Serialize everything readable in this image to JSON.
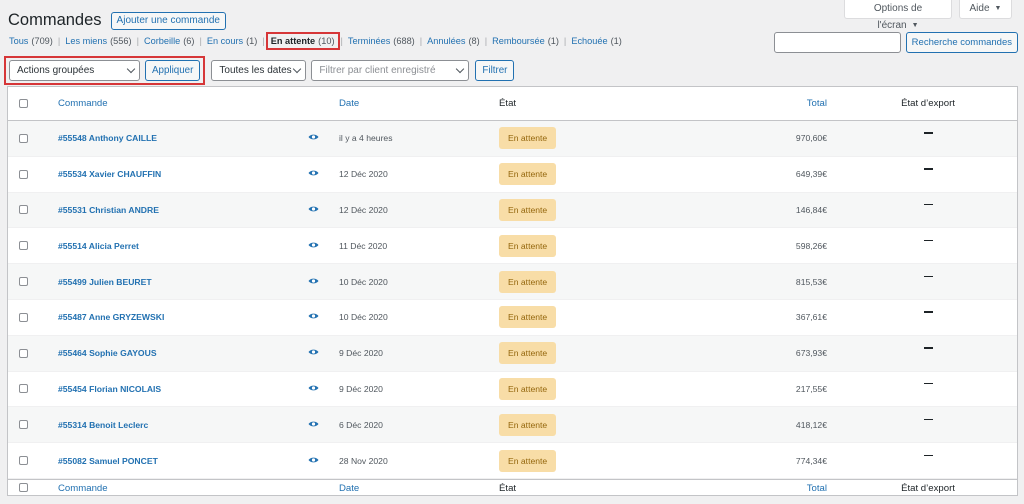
{
  "screen_meta": {
    "options_label": "Options de l'écran",
    "help_label": "Aide"
  },
  "page": {
    "title": "Commandes",
    "add_button": "Ajouter une commande"
  },
  "filters": [
    {
      "label": "Tous",
      "count": "(709)"
    },
    {
      "label": "Les miens",
      "count": "(556)"
    },
    {
      "label": "Corbeille",
      "count": "(6)"
    },
    {
      "label": "En cours",
      "count": "(1)"
    },
    {
      "label": "En attente",
      "count": "(10)",
      "current": true
    },
    {
      "label": "Terminées",
      "count": "(688)"
    },
    {
      "label": "Annulées",
      "count": "(8)"
    },
    {
      "label": "Remboursée",
      "count": "(1)"
    },
    {
      "label": "Echouée",
      "count": "(1)"
    }
  ],
  "search": {
    "value": "",
    "button": "Recherche commandes"
  },
  "tablenav": {
    "bulk_select": "Actions groupées",
    "apply": "Appliquer",
    "dates_select": "Toutes les dates",
    "customer_placeholder": "Filtrer par client enregistré",
    "filter": "Filtrer"
  },
  "columns": {
    "order": "Commande",
    "date": "Date",
    "state": "État",
    "total": "Total",
    "export": "État d’export"
  },
  "orders": [
    {
      "order": "#55548 Anthony CAILLE",
      "date": "il y a 4 heures",
      "state": "En attente",
      "total": "970,60€"
    },
    {
      "order": "#55534 Xavier CHAUFFIN",
      "date": "12 Déc 2020",
      "state": "En attente",
      "total": "649,39€"
    },
    {
      "order": "#55531 Christian ANDRE",
      "date": "12 Déc 2020",
      "state": "En attente",
      "total": "146,84€"
    },
    {
      "order": "#55514 Alicia Perret",
      "date": "11 Déc 2020",
      "state": "En attente",
      "total": "598,26€"
    },
    {
      "order": "#55499 Julien BEURET",
      "date": "10 Déc 2020",
      "state": "En attente",
      "total": "815,53€"
    },
    {
      "order": "#55487 Anne GRYZEWSKI",
      "date": "10 Déc 2020",
      "state": "En attente",
      "total": "367,61€"
    },
    {
      "order": "#55464 Sophie GAYOUS",
      "date": "9 Déc 2020",
      "state": "En attente",
      "total": "673,93€"
    },
    {
      "order": "#55454 Florian NICOLAIS",
      "date": "9 Déc 2020",
      "state": "En attente",
      "total": "217,55€"
    },
    {
      "order": "#55314 Benoit Leclerc",
      "date": "6 Déc 2020",
      "state": "En attente",
      "total": "418,12€"
    },
    {
      "order": "#55082 Samuel PONCET",
      "date": "28 Nov 2020",
      "state": "En attente",
      "total": "774,34€"
    }
  ],
  "colors": {
    "link": "#2271b1",
    "highlight": "#d63638",
    "badge_bg": "#f8dda7",
    "badge_text": "#94660c"
  }
}
